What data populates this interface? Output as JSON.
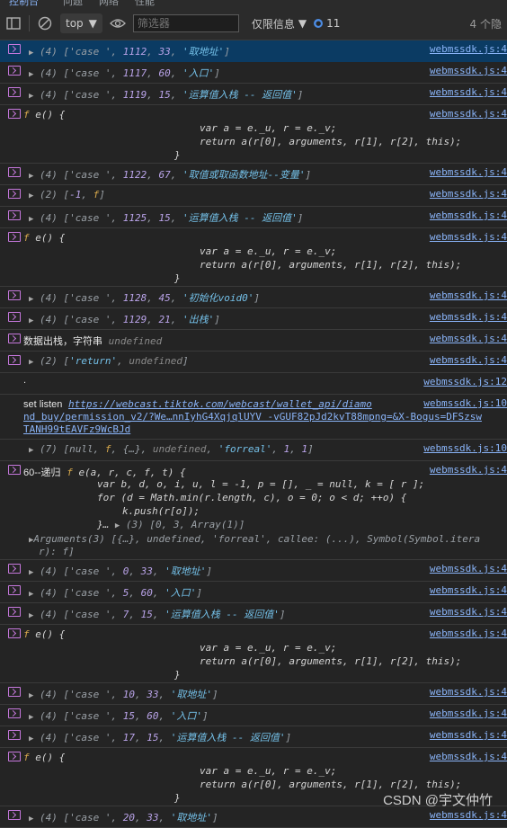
{
  "tabs": [
    "控制台",
    "问题",
    "网络",
    "性能"
  ],
  "toolbar": {
    "context": "top",
    "filter_placeholder": "筛选器",
    "levels": "仅限信息",
    "issues_count": "11",
    "hidden_count": "4 个隐"
  },
  "source_file": "webmssdk.js:4",
  "source_file_12": "webmssdk.js:12",
  "source_file_10": "webmssdk.js:10",
  "fn_body": {
    "sig": "e() {",
    "l1": "var a = e._u, r = e._v;",
    "l2": "return a(r[0], arguments, r[1], r[2], this);",
    "l3": "}"
  },
  "rows": [
    {
      "p": "(4) ['case ', ",
      "n": "1112",
      "m": "33",
      "s": "'取地址'"
    },
    {
      "p": "(4) ['case ', ",
      "n": "1117",
      "m": "60",
      "s": "'入口'"
    },
    {
      "p": "(4) ['case ', ",
      "n": "1119",
      "m": "15",
      "s": "'运算值入栈 -- 返回值'"
    },
    {
      "p": "(4) ['case ', ",
      "n": "1122",
      "m": "67",
      "s": "'取值或取函数地址--变量'"
    },
    {
      "p": "(2) [",
      "n": "-1",
      "m": "f"
    },
    {
      "p": "(4) ['case ', ",
      "n": "1125",
      "m": "15",
      "s": "'运算值入栈 -- 返回值'"
    },
    {
      "p": "(4) ['case ', ",
      "n": "1128",
      "m": "45",
      "s": "'初始化void0'"
    },
    {
      "p": "(4) ['case ', ",
      "n": "1129",
      "m": "21",
      "s": "'出栈'"
    },
    {
      "p": "(4) ['case ', ",
      "n": "0",
      "m": "33",
      "s": "'取地址'"
    },
    {
      "p": "(4) ['case ', ",
      "n": "5",
      "m": "60",
      "s": "'入口'"
    },
    {
      "p": "(4) ['case ', ",
      "n": "7",
      "m": "15",
      "s": "'运算值入栈 -- 返回值'"
    },
    {
      "p": "(4) ['case ', ",
      "n": "10",
      "m": "33",
      "s": "'取地址'"
    },
    {
      "p": "(4) ['case ', ",
      "n": "15",
      "m": "60",
      "s": "'入口'"
    },
    {
      "p": "(4) ['case ', ",
      "n": "17",
      "m": "15",
      "s": "'运算值入栈 -- 返回值'"
    },
    {
      "p": "(4) ['case ', ",
      "n": "20",
      "m": "33",
      "s": "'取地址'"
    }
  ],
  "stack_out": {
    "label": "数据出栈，字符串",
    "value": "undefined"
  },
  "return_row": {
    "p": "(2) [",
    "s": "'return'",
    "u": "undefined"
  },
  "dot_row": ".",
  "set_listen": {
    "label": "set listen",
    "url1": "https://webcast.tiktok.com/webcast/wallet_api/diamo",
    "url2": "nd_buy/permission_v2/?We…nnIyhG4XqjqlUYV -vGUF82pJd2kvT88mpng=&X-Bogus=DFSzsw",
    "url3": "TANH99tEAVFz9WcBJd"
  },
  "seven_row": {
    "a": "(7) [",
    "b": "null",
    "c": "f",
    "d": "{…}",
    "e": "undefined",
    "f": "'forreal'",
    "g": "1",
    "h": "1"
  },
  "recursion": {
    "label": "60--递归",
    "sig": "e(a, r, c, f, t) {",
    "l1": "var b, d, o, i, u, l = -1, p = [], _ = null, k = [ r ];",
    "l2": "for (d = Math.min(r.length, c), o = 0; o < d; ++o) {",
    "l3": "k.push(r[o]);",
    "l4": "}…",
    "l4b": "(3) [0, 3, Array(1)]",
    "args1": "Arguments(3) [{…}, undefined, 'forreal', callee: (...), Symbol(Symbol.itera",
    "args2": "r): f]"
  },
  "watermark": "CSDN @宇文仲竹"
}
